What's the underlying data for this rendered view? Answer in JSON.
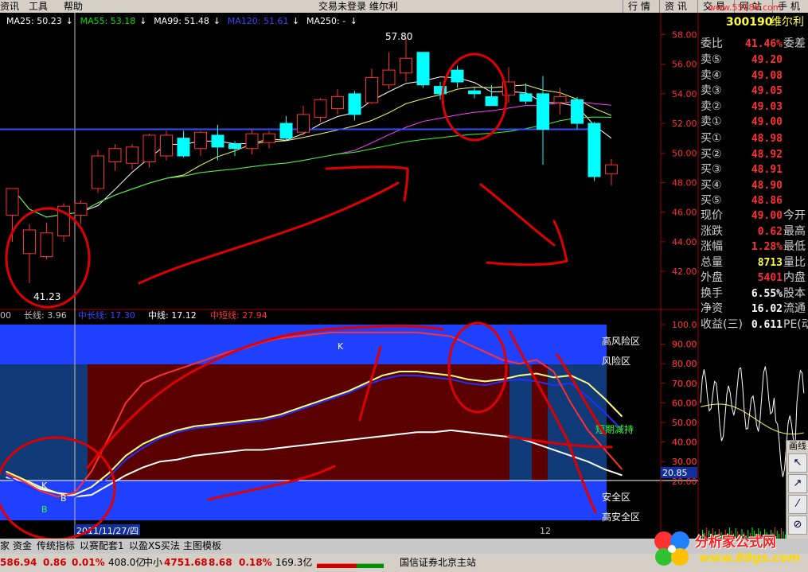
{
  "menu": {
    "items": [
      "资讯",
      "工具",
      "帮助"
    ],
    "title": "交易未登录 维尔利",
    "tabs": [
      "行 情",
      "资 讯",
      "交 易",
      "网 站",
      "手 机"
    ],
    "watermark_url": "www.55188.com"
  },
  "ma_legend": [
    {
      "label": "MA25: 50.23",
      "color": "#ffffff"
    },
    {
      "label": "MA55: 53.18",
      "color": "#00e000"
    },
    {
      "label": "MA99: 51.48",
      "color": "#ffffff"
    },
    {
      "label": "MA120: 51.61",
      "color": "#4040ff"
    },
    {
      "label": "MA250: -",
      "color": "#ffffff"
    }
  ],
  "indicator_legend": [
    {
      "label": "00",
      "color": "#c0c0c0"
    },
    {
      "label": "长线: 3.96",
      "color": "#c0c0c0"
    },
    {
      "label": "中长线: 17.30",
      "color": "#4040ff"
    },
    {
      "label": "中线: 17.12",
      "color": "#ffffff"
    },
    {
      "label": "中短线: 27.94",
      "color": "#ff3030"
    }
  ],
  "chart_data": [
    {
      "type": "candlestick",
      "y_ticks": [
        "58.00",
        "56.00",
        "54.00",
        "52.00",
        "50.00",
        "48.00",
        "46.00",
        "44.00",
        "42.00"
      ],
      "ylim": [
        41.2,
        58.4
      ],
      "high_label": "57.80",
      "low_label": "41.23",
      "candles": [
        {
          "o": 45.8,
          "h": 47.0,
          "l": 44.0,
          "c": 47.6
        },
        {
          "o": 43.2,
          "h": 45.2,
          "l": 41.2,
          "c": 44.8
        },
        {
          "o": 43.0,
          "h": 45.3,
          "l": 42.8,
          "c": 44.6
        },
        {
          "o": 44.4,
          "h": 46.6,
          "l": 44.0,
          "c": 46.4
        },
        {
          "o": 45.8,
          "h": 46.8,
          "l": 45.2,
          "c": 46.6
        },
        {
          "o": 47.6,
          "h": 50.2,
          "l": 47.3,
          "c": 49.8
        },
        {
          "o": 49.4,
          "h": 50.6,
          "l": 48.8,
          "c": 50.3
        },
        {
          "o": 49.3,
          "h": 50.6,
          "l": 48.9,
          "c": 50.4
        },
        {
          "o": 49.4,
          "h": 51.3,
          "l": 49.0,
          "c": 51.2
        },
        {
          "o": 49.8,
          "h": 51.5,
          "l": 49.5,
          "c": 51.2
        },
        {
          "o": 51.0,
          "h": 51.5,
          "l": 49.7,
          "c": 49.8
        },
        {
          "o": 50.3,
          "h": 51.5,
          "l": 49.8,
          "c": 51.4
        },
        {
          "o": 51.2,
          "h": 51.9,
          "l": 49.5,
          "c": 50.4
        },
        {
          "o": 50.6,
          "h": 50.8,
          "l": 49.8,
          "c": 50.3
        },
        {
          "o": 50.3,
          "h": 51.6,
          "l": 49.9,
          "c": 51.3
        },
        {
          "o": 50.7,
          "h": 51.5,
          "l": 50.3,
          "c": 51.3
        },
        {
          "o": 52.0,
          "h": 52.5,
          "l": 50.8,
          "c": 51.0
        },
        {
          "o": 51.4,
          "h": 53.2,
          "l": 51.2,
          "c": 52.6
        },
        {
          "o": 52.4,
          "h": 53.7,
          "l": 52.1,
          "c": 53.6
        },
        {
          "o": 53.0,
          "h": 54.3,
          "l": 52.6,
          "c": 53.8
        },
        {
          "o": 54.0,
          "h": 54.2,
          "l": 52.2,
          "c": 52.6
        },
        {
          "o": 53.4,
          "h": 55.7,
          "l": 53.3,
          "c": 55.1
        },
        {
          "o": 54.6,
          "h": 56.8,
          "l": 54.3,
          "c": 55.6
        },
        {
          "o": 55.4,
          "h": 57.8,
          "l": 54.8,
          "c": 56.4
        },
        {
          "o": 56.8,
          "h": 56.8,
          "l": 54.4,
          "c": 54.6
        },
        {
          "o": 54.5,
          "h": 54.8,
          "l": 53.6,
          "c": 54.0
        },
        {
          "o": 55.6,
          "h": 55.9,
          "l": 54.4,
          "c": 54.8
        },
        {
          "o": 54.2,
          "h": 54.4,
          "l": 53.7,
          "c": 54.0
        },
        {
          "o": 53.8,
          "h": 54.6,
          "l": 53.4,
          "c": 53.2
        },
        {
          "o": 53.9,
          "h": 55.8,
          "l": 53.4,
          "c": 54.8
        },
        {
          "o": 54.0,
          "h": 54.7,
          "l": 53.3,
          "c": 53.5
        },
        {
          "o": 54.0,
          "h": 55.2,
          "l": 49.2,
          "c": 51.6
        },
        {
          "o": 53.4,
          "h": 54.4,
          "l": 52.6,
          "c": 53.8
        },
        {
          "o": 53.6,
          "h": 53.8,
          "l": 51.6,
          "c": 52.0
        },
        {
          "o": 52.0,
          "h": 52.1,
          "l": 48.1,
          "c": 48.4
        },
        {
          "o": 48.6,
          "h": 49.6,
          "l": 47.8,
          "c": 49.2
        }
      ]
    },
    {
      "type": "line",
      "y_ticks": [
        "100.0",
        "90.00",
        "80.00",
        "70.00",
        "60.00",
        "50.00",
        "40.00",
        "30.00",
        "20.00"
      ],
      "ylim": [
        0,
        100
      ],
      "zone_labels": [
        "高风险区",
        "风险区",
        "短期减持",
        "安全区",
        "高安全区"
      ],
      "markers": [
        "K",
        "K",
        "B",
        "B"
      ],
      "date_label": "2011/11/27/四",
      "month_label": "12",
      "series": [
        {
          "color": "#ffffff",
          "values": [
            22,
            20,
            16,
            14,
            12,
            13,
            18,
            23,
            27,
            30,
            31,
            33,
            34,
            35,
            36,
            36,
            37,
            38,
            39,
            40,
            41,
            42,
            43,
            44,
            45,
            45,
            46,
            45,
            44,
            43,
            42,
            39,
            36,
            33,
            30,
            26,
            23
          ]
        },
        {
          "color": "#ffff80",
          "values": [
            25,
            21,
            17,
            14,
            13,
            17,
            24,
            33,
            39,
            43,
            46,
            48,
            49,
            50,
            51,
            52,
            54,
            57,
            60,
            63,
            66,
            70,
            74,
            76,
            76,
            75,
            74,
            72,
            71,
            72,
            74,
            75,
            73,
            74,
            70,
            62,
            53
          ]
        },
        {
          "color": "#2030ff",
          "values": [
            23,
            18,
            15,
            12,
            12,
            16,
            22,
            31,
            37,
            42,
            45,
            47,
            48,
            49,
            50,
            51,
            53,
            56,
            59,
            62,
            65,
            69,
            72,
            74,
            74,
            73,
            72,
            70,
            69,
            71,
            72,
            71,
            69,
            70,
            63,
            55,
            46
          ]
        },
        {
          "color": "#ff3030",
          "values": [
            24,
            20,
            15,
            12,
            14,
            25,
            42,
            60,
            70,
            74,
            77,
            80,
            83,
            86,
            88,
            91,
            93,
            94,
            95,
            96,
            96,
            96,
            96,
            96,
            96,
            95,
            94,
            90,
            86,
            82,
            80,
            82,
            76,
            60,
            46,
            36,
            26
          ]
        }
      ]
    }
  ],
  "right_axis_current": "20.85",
  "quote": {
    "code": "300190",
    "name": "维尔利",
    "weibi": {
      "label": "委比",
      "value": "41.46%",
      "right": "委差"
    },
    "asks": [
      {
        "label": "卖⑤",
        "value": "49.20"
      },
      {
        "label": "卖④",
        "value": "49.08"
      },
      {
        "label": "卖③",
        "value": "49.05"
      },
      {
        "label": "卖②",
        "value": "49.03"
      },
      {
        "label": "卖①",
        "value": "49.00"
      }
    ],
    "bids": [
      {
        "label": "买①",
        "value": "48.98"
      },
      {
        "label": "买②",
        "value": "48.92"
      },
      {
        "label": "买③",
        "value": "48.91"
      },
      {
        "label": "买④",
        "value": "48.90"
      },
      {
        "label": "买⑤",
        "value": "48.86"
      }
    ],
    "stats": [
      {
        "label": "现价",
        "value": "49.00",
        "right": "今开",
        "color": "#ff3030"
      },
      {
        "label": "涨跌",
        "value": "0.62",
        "right": "最高",
        "color": "#ff3030"
      },
      {
        "label": "涨幅",
        "value": "1.28%",
        "right": "最低",
        "color": "#ff3030"
      },
      {
        "label": "总量",
        "value": "8713",
        "right": "量比",
        "color": "#ffff40"
      },
      {
        "label": "外盘",
        "value": "5401",
        "right": "内盘",
        "color": "#ff3030"
      },
      {
        "label": "换手",
        "value": "6.55%",
        "right": "股本",
        "color": "#ffffff"
      },
      {
        "label": "净资",
        "value": "16.02",
        "right": "流通",
        "color": "#ffffff"
      },
      {
        "label": "收益(三)",
        "value": "0.611",
        "right": "PE(动",
        "color": "#ffffff"
      }
    ]
  },
  "minichart_ticks": [
    "90.00",
    "80.00",
    "70.00",
    "60.00",
    "50.00",
    "40.00",
    "30.00"
  ],
  "bottom_tabs": [
    "家",
    "资金",
    "传统指标",
    "以赛配套1",
    "以盈XS买法",
    "主图模板"
  ],
  "status": {
    "index1_value": "586.94",
    "index1_change": "0.86",
    "index1_pct": "0.01%",
    "index1_amount": "408.0亿",
    "index2_name": "中小",
    "index2_value": "4751.68",
    "index2_change": "8.68",
    "index2_pct": "0.18%",
    "index2_amount": "169.3亿",
    "broker": "国信证券北京主站"
  },
  "toolbox": {
    "title": "画线",
    "buttons": [
      "↖",
      "↗",
      "⁄",
      "⊘"
    ]
  },
  "watermark": {
    "title": "分析家公式网",
    "url": "www.88gs.com"
  }
}
